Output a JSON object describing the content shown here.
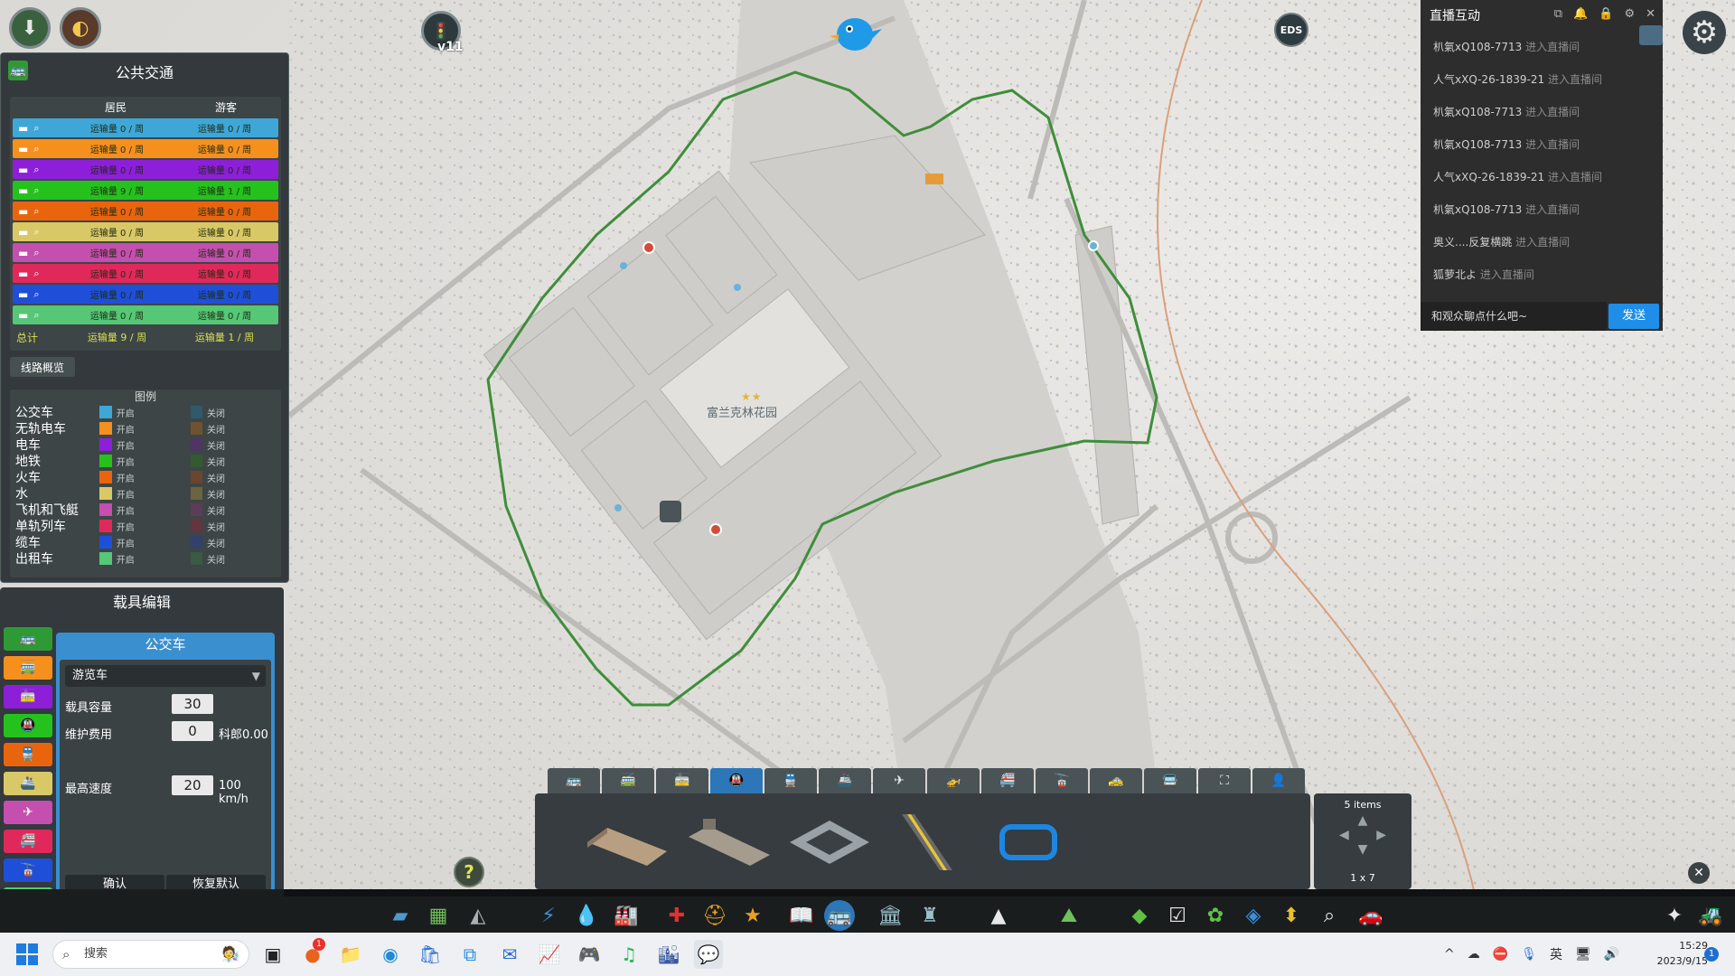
{
  "map": {
    "district_label": "富兰克林花园",
    "stars": "★★"
  },
  "hud": {
    "version": "v11",
    "eds_label": "EDS"
  },
  "public_transport": {
    "title": "公共交通",
    "col_residents": "居民",
    "col_tourists": "游客",
    "rows": [
      {
        "color": "#3ea7d8",
        "residents": "运输量 0 / 周",
        "tourists": "运输量 0 / 周"
      },
      {
        "color": "#f5901e",
        "residents": "运输量 0 / 周",
        "tourists": "运输量 0 / 周"
      },
      {
        "color": "#8d1fd8",
        "residents": "运输量 0 / 周",
        "tourists": "运输量 0 / 周"
      },
      {
        "color": "#25c21d",
        "residents": "运输量 9 / 周",
        "tourists": "运输量 1 / 周"
      },
      {
        "color": "#e8650e",
        "residents": "运输量 0 / 周",
        "tourists": "运输量 0 / 周"
      },
      {
        "color": "#d9c866",
        "residents": "运输量 0 / 周",
        "tourists": "运输量 0 / 周"
      },
      {
        "color": "#c44fae",
        "residents": "运输量 0 / 周",
        "tourists": "运输量 0 / 周"
      },
      {
        "color": "#e0295a",
        "residents": "运输量 0 / 周",
        "tourists": "运输量 0 / 周"
      },
      {
        "color": "#1f4fd8",
        "residents": "运输量 0 / 周",
        "tourists": "运输量 0 / 周"
      },
      {
        "color": "#55c776",
        "residents": "运输量 0 / 周",
        "tourists": "运输量 0 / 周"
      }
    ],
    "total_label": "总计",
    "total_residents": "运输量 9 / 周",
    "total_tourists": "运输量 1 / 周",
    "line_overview": "线路概览",
    "legend_title": "图例",
    "legend": [
      {
        "name": "公交车",
        "on_color": "#3ea7d8",
        "off_color": "#2f5a6c",
        "on": "开启",
        "off": "关闭"
      },
      {
        "name": "无轨电车",
        "on_color": "#f5901e",
        "off_color": "#6f5230",
        "on": "开启",
        "off": "关闭"
      },
      {
        "name": "电车",
        "on_color": "#8d1fd8",
        "off_color": "#4f3564",
        "on": "开启",
        "off": "关闭"
      },
      {
        "name": "地铁",
        "on_color": "#25c21d",
        "off_color": "#335a30",
        "on": "开启",
        "off": "关闭"
      },
      {
        "name": "火车",
        "on_color": "#e8650e",
        "off_color": "#6a4530",
        "on": "开启",
        "off": "关闭"
      },
      {
        "name": "水",
        "on_color": "#d9c866",
        "off_color": "#6a6440",
        "on": "开启",
        "off": "关闭"
      },
      {
        "name": "飞机和飞艇",
        "on_color": "#c44fae",
        "off_color": "#5e3b56",
        "on": "开启",
        "off": "关闭"
      },
      {
        "name": "单轨列车",
        "on_color": "#e0295a",
        "off_color": "#64343f",
        "on": "开启",
        "off": "关闭"
      },
      {
        "name": "缆车",
        "on_color": "#1f4fd8",
        "off_color": "#33406a",
        "on": "开启",
        "off": "关闭"
      },
      {
        "name": "出租车",
        "on_color": "#55c776",
        "off_color": "#3a5a44",
        "on": "开启",
        "off": "关闭"
      }
    ]
  },
  "vehicle_editor": {
    "title": "载具编辑",
    "category": "公交车",
    "selected_vehicle": "游览车",
    "capacity_label": "载具容量",
    "capacity": "30",
    "maintenance_label": "维护费用",
    "maintenance": "0",
    "maintenance_suffix": "科郎0.00",
    "max_speed_label": "最高速度",
    "max_speed": "20",
    "max_speed_suffix": "100 km/h",
    "confirm": "确认",
    "reset": "恢复默认",
    "tab_colors": [
      "#2e9a36",
      "#f5901e",
      "#8d1fd8",
      "#25c21d",
      "#e8650e",
      "#d9c866",
      "#c44fae",
      "#e0295a",
      "#1f4fd8",
      "#55c776"
    ]
  },
  "grid_panel": {
    "items": "5 items",
    "size": "1 x 7"
  },
  "chat": {
    "title": "直播互动",
    "messages": [
      {
        "user": "朳氣xQ108-7713",
        "action": "进入直播间"
      },
      {
        "user": "人气xXQ-26-1839-21",
        "action": "进入直播间"
      },
      {
        "user": "朳氣xQ108-7713",
        "action": "进入直播间"
      },
      {
        "user": "朳氣xQ108-7713",
        "action": "进入直播间"
      },
      {
        "user": "人气xXQ-26-1839-21",
        "action": "进入直播间"
      },
      {
        "user": "朳氣xQ108-7713",
        "action": "进入直播间"
      },
      {
        "user": "奥义....反复横跳",
        "action": "进入直播间"
      },
      {
        "user": "狐萝北よ",
        "action": "进入直播间"
      }
    ],
    "input_placeholder": "和观众聊点什么吧~",
    "send": "发送"
  },
  "taskbar": {
    "search_placeholder": "搜索",
    "ime": "英",
    "time": "15:29",
    "date": "2023/9/15",
    "notification_count": "1",
    "app_badge": "1"
  }
}
